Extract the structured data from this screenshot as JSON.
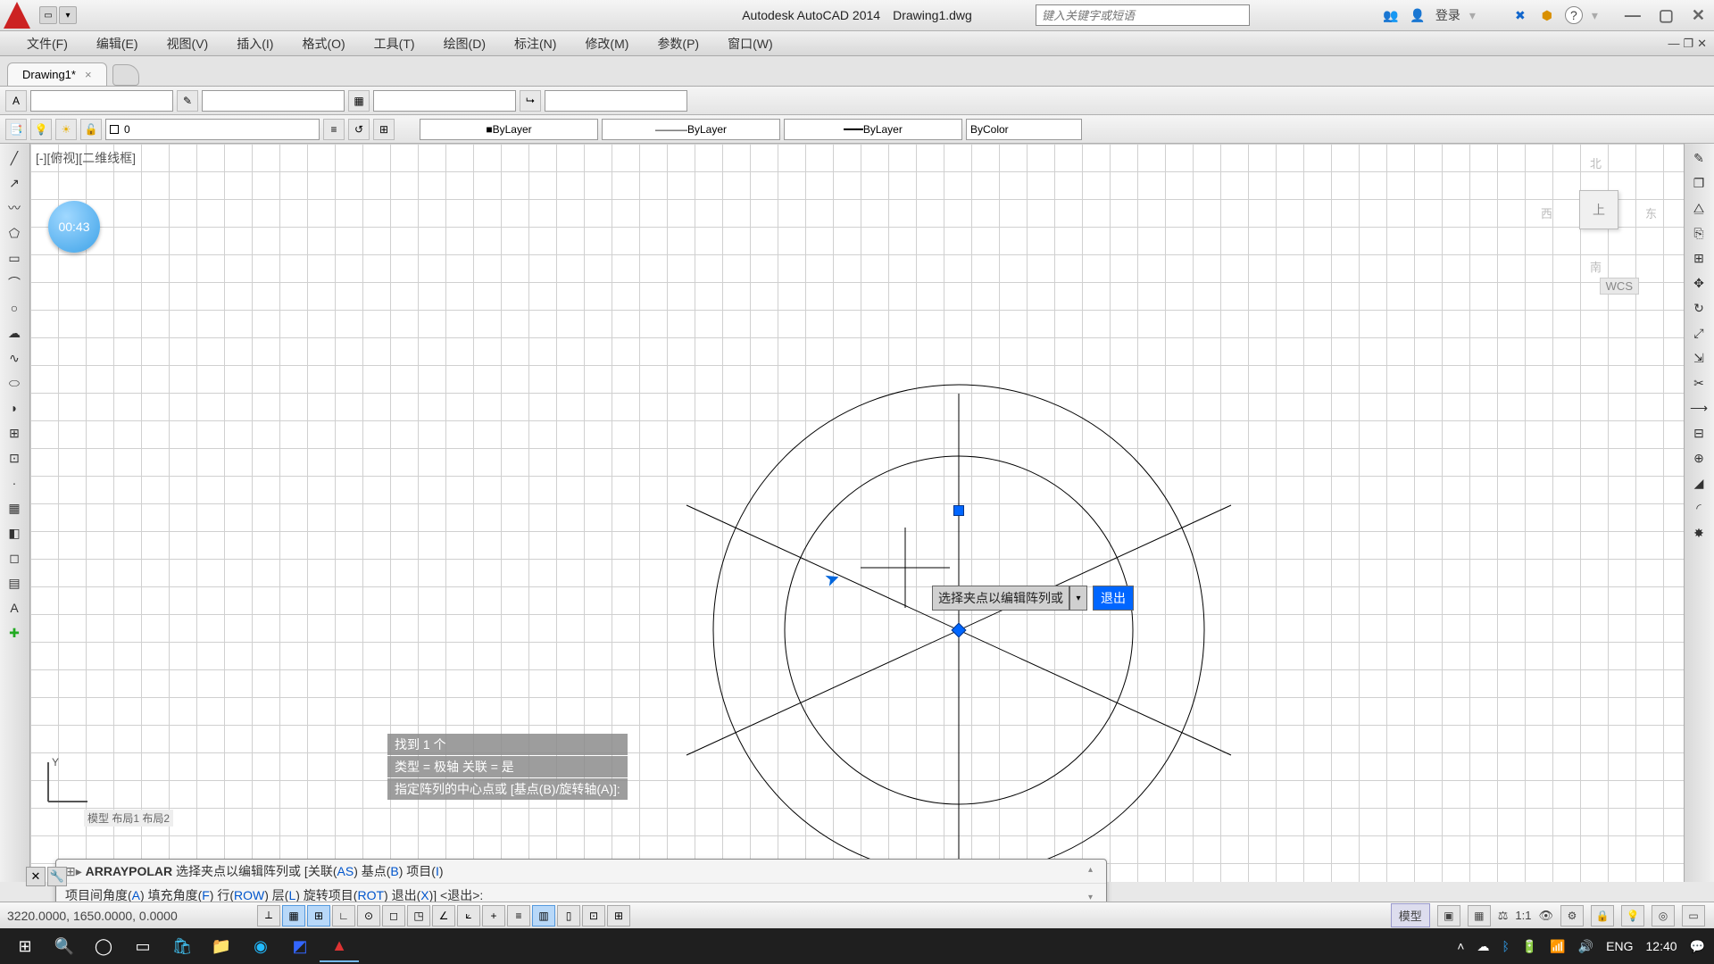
{
  "app": {
    "title": "Autodesk AutoCAD 2014",
    "document": "Drawing1.dwg"
  },
  "search": {
    "placeholder": "键入关键字或短语"
  },
  "login": "登录",
  "menu": [
    "文件(F)",
    "编辑(E)",
    "视图(V)",
    "插入(I)",
    "格式(O)",
    "工具(T)",
    "绘图(D)",
    "标注(N)",
    "修改(M)",
    "参数(P)",
    "窗口(W)"
  ],
  "doc_tab": {
    "name": "Drawing1*",
    "close": "×"
  },
  "layer": {
    "current": "0"
  },
  "props": {
    "color": "ByLayer",
    "ltype": "ByLayer",
    "lweight": "ByLayer",
    "plot": "ByColor"
  },
  "viewport_label": "[-][俯视][二维线框]",
  "timer": "00:43",
  "viewcube": {
    "top": "上",
    "n": "北",
    "s": "南",
    "e": "东",
    "w": "西",
    "wcs": "WCS"
  },
  "dyn_prompt": {
    "text": "选择夹点以编辑阵列或",
    "exit": "退出"
  },
  "cmd_history": [
    "找到 1 个",
    "类型 = 极轴  关联 = 是",
    "指定阵列的中心点或 [基点(B)/旋转轴(A)]:"
  ],
  "cmd_panel": {
    "icon_cmd": "ARRAYPOLAR",
    "line1_a": "选择夹点以编辑阵列或 [关联(",
    "line1_as": "AS",
    "line1_b": ")  基点(",
    "line1_bk": "B",
    "line1_c": ")  项目(",
    "line1_ik": "I",
    "line1_d": ")",
    "line2_a": "项目间角度(",
    "line2_ak": "A",
    "line2_b": ")  填充角度(",
    "line2_fk": "F",
    "line2_c": ")  行(",
    "line2_rk": "ROW",
    "line2_d": ")  层(",
    "line2_lk": "L",
    "line2_e": ")  旋转项目(",
    "line2_rotk": "ROT",
    "line2_f": ")  退出(",
    "line2_xk": "X",
    "line2_g": ")] <退出>:"
  },
  "status": {
    "coords": "3220.0000, 1650.0000, 0.0000",
    "right_model": "模型",
    "scale": "1:1"
  },
  "model_tabs": "模型  布局1  布局2",
  "taskbar": {
    "lang": "ENG",
    "time": "12:40"
  }
}
